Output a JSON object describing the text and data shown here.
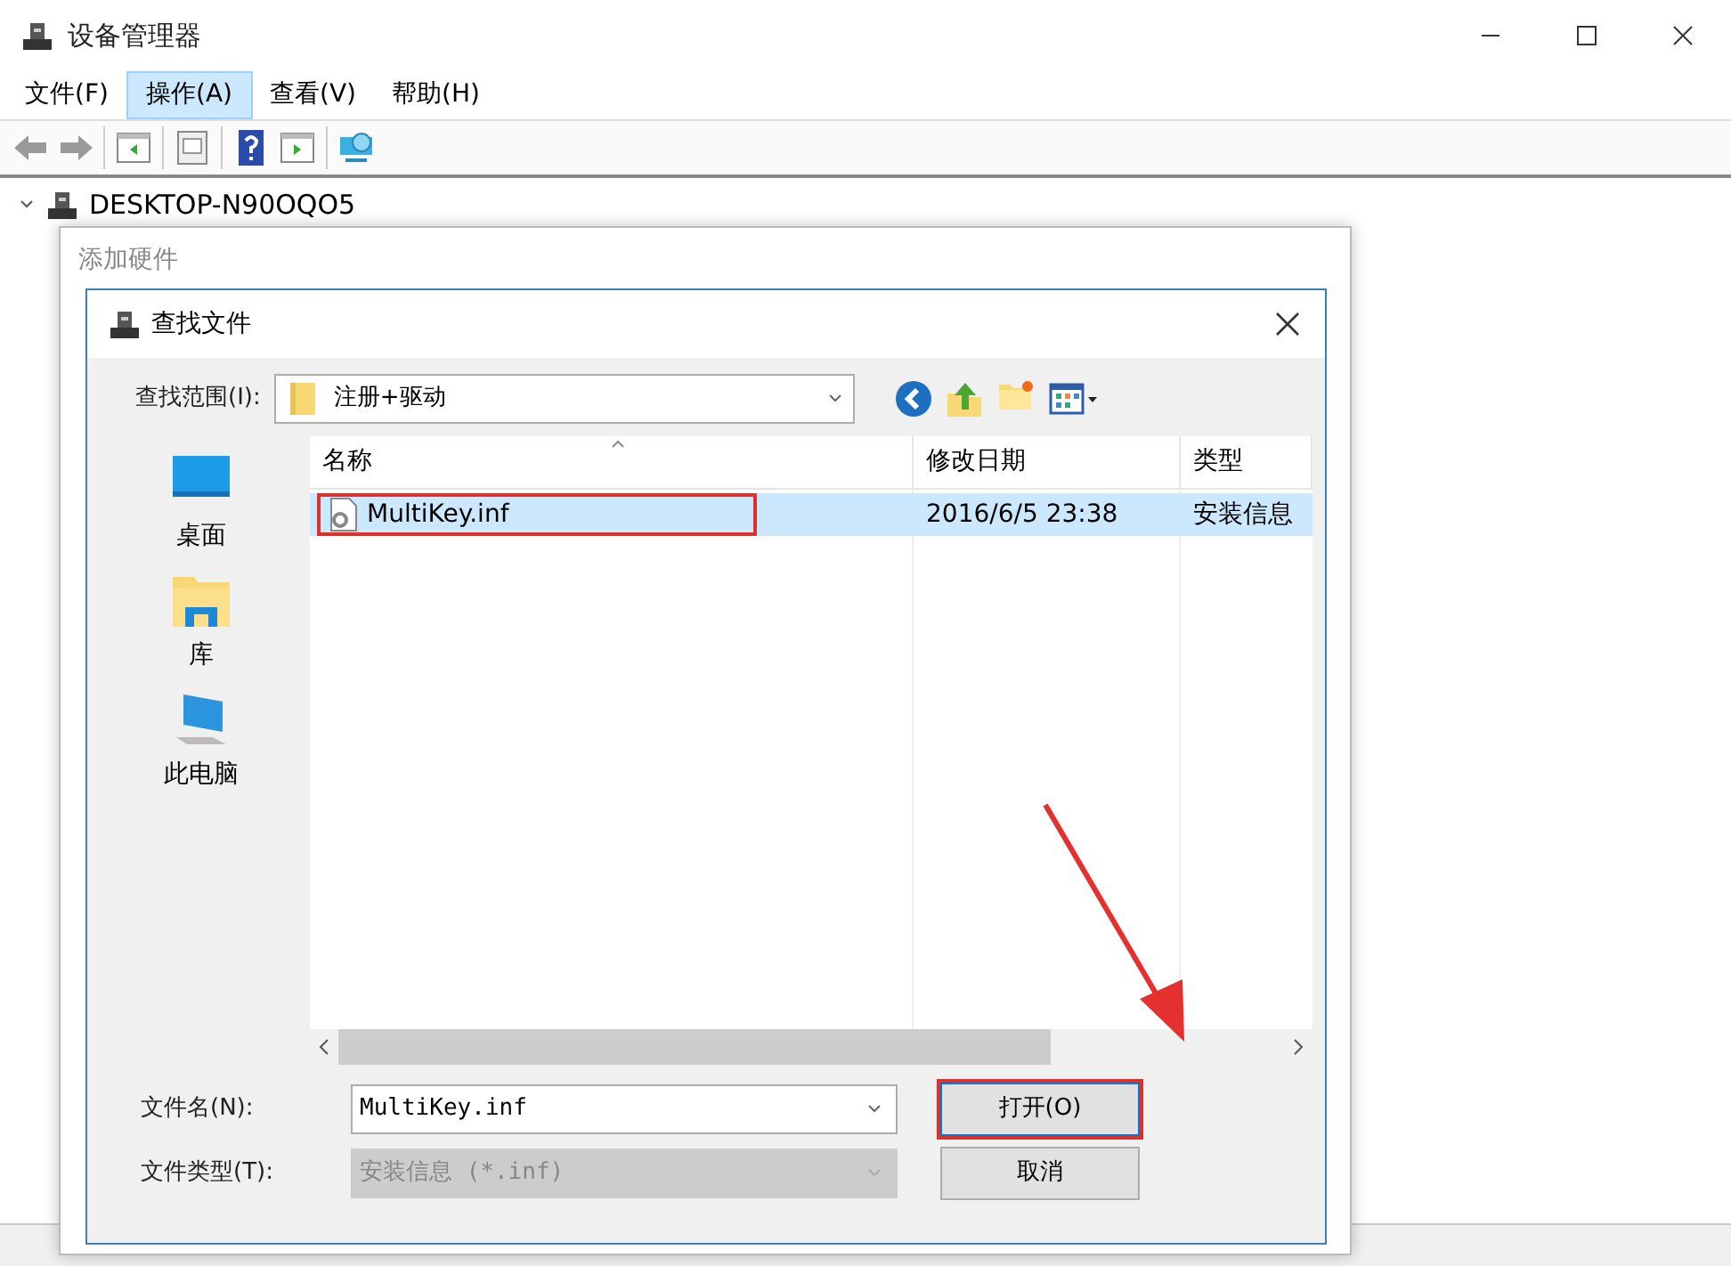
{
  "window": {
    "title": "设备管理器"
  },
  "menu": [
    {
      "label": "文件(F)",
      "selected": false
    },
    {
      "label": "操作(A)",
      "selected": true
    },
    {
      "label": "查看(V)",
      "selected": false
    },
    {
      "label": "帮助(H)",
      "selected": false
    }
  ],
  "tree": [
    {
      "label": "DESKTOP-N90OQO5",
      "expanded": true
    }
  ],
  "wizard": {
    "title": "添加硬件"
  },
  "dialog": {
    "title": "查找文件",
    "look_in": {
      "label": "查找范围(I):",
      "value": "注册+驱动"
    },
    "places": [
      {
        "label": "桌面",
        "kind": "desktop"
      },
      {
        "label": "库",
        "kind": "library"
      },
      {
        "label": "此电脑",
        "kind": "computer"
      }
    ],
    "columns": [
      {
        "label": "名称",
        "sorted": true
      },
      {
        "label": "修改日期",
        "sorted": false
      },
      {
        "label": "类型",
        "sorted": false
      }
    ],
    "rows": [
      {
        "name": "MultiKey.inf",
        "date": "2016/6/5 23:38",
        "type": "安装信息",
        "selected": true,
        "highlighted": true
      }
    ],
    "file_name": {
      "label": "文件名(N):",
      "value": "MultiKey.inf"
    },
    "file_type": {
      "label": "文件类型(T):",
      "value": "安装信息 (*.inf)",
      "disabled": true
    },
    "buttons": [
      {
        "label": "打开(O)",
        "highlighted": true
      },
      {
        "label": "取消",
        "highlighted": false
      }
    ],
    "pointer_arrow": true
  }
}
